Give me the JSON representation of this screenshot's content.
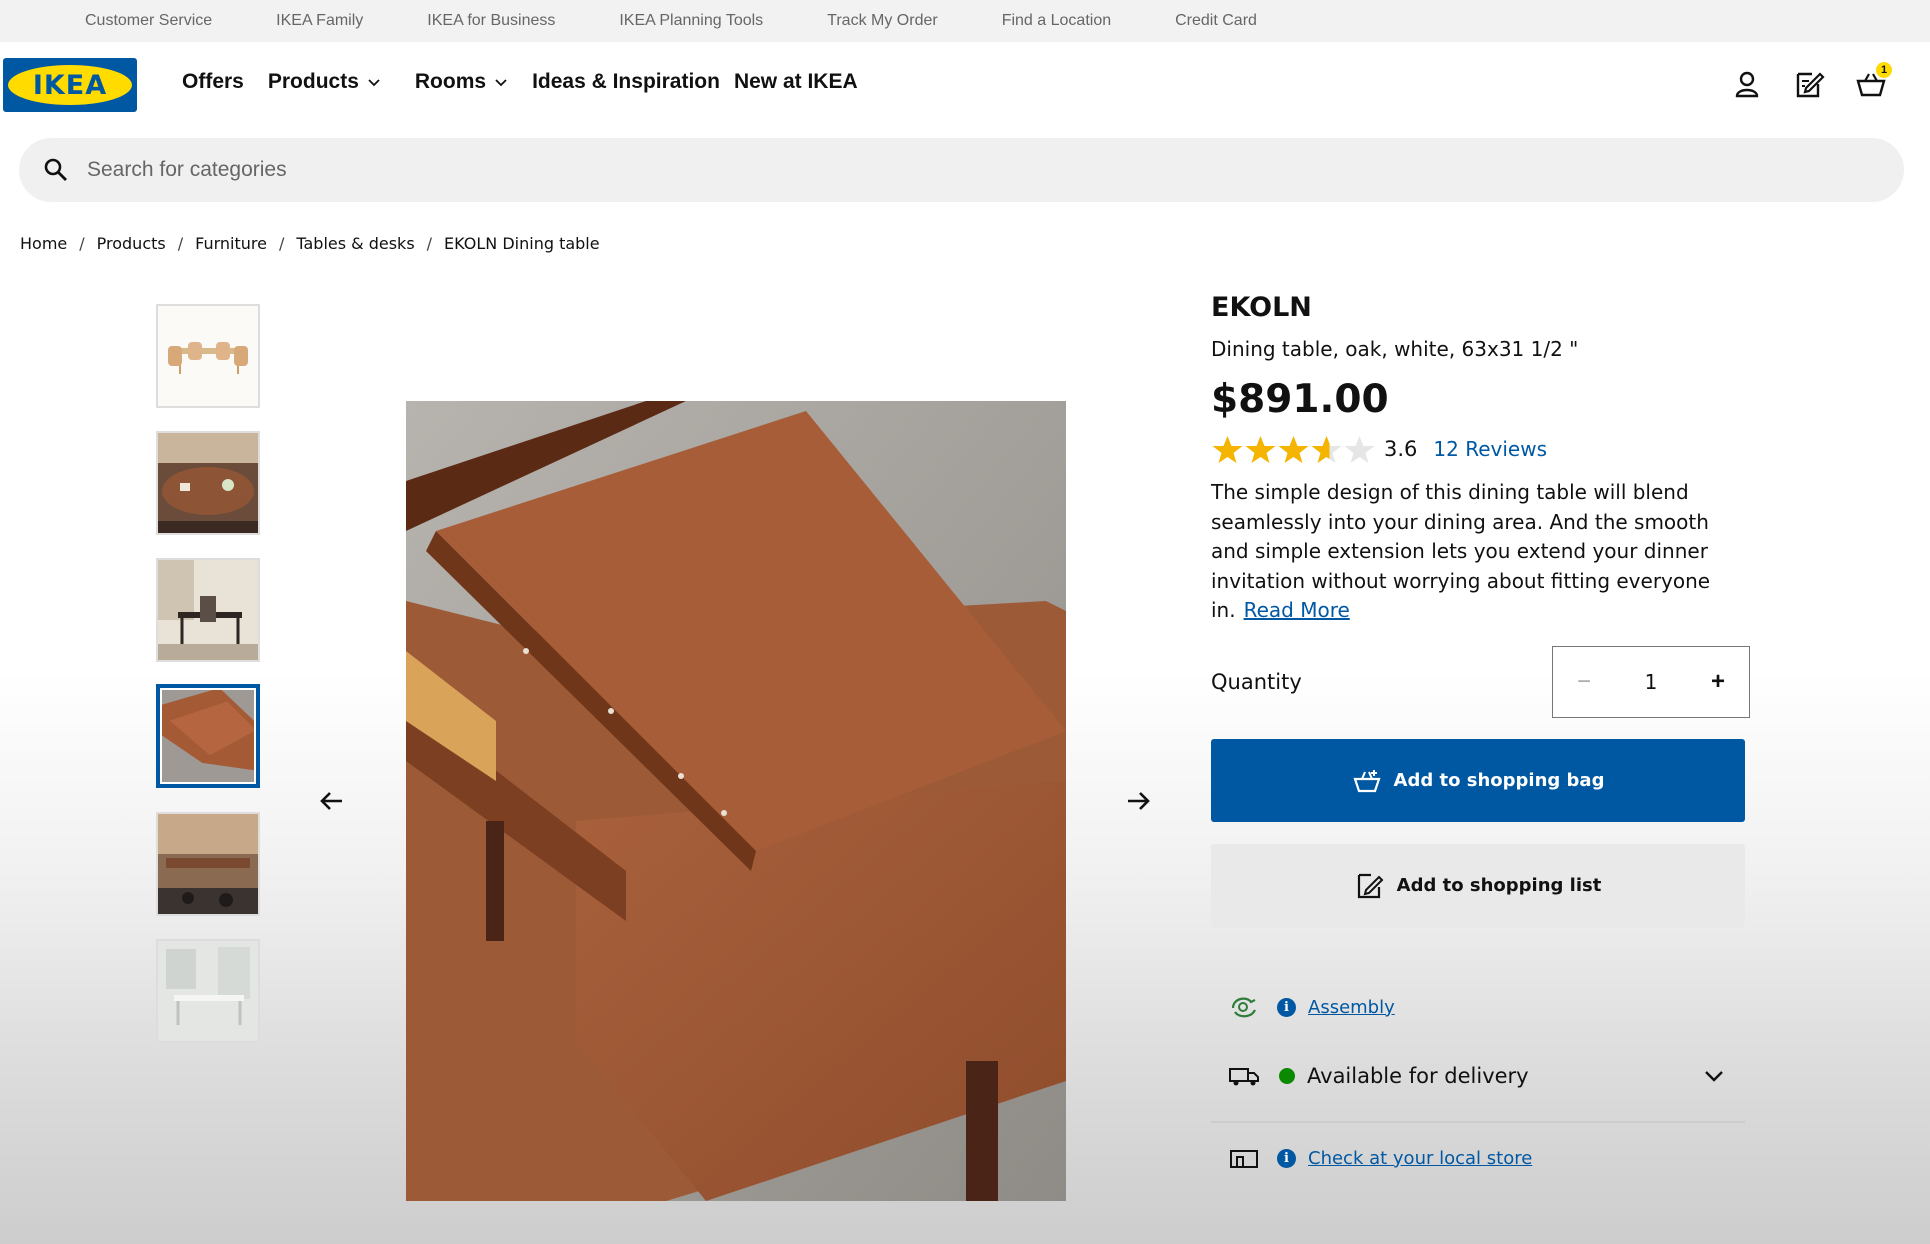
{
  "utility": [
    "Customer Service",
    "IKEA Family",
    "IKEA for Business",
    "IKEA Planning Tools",
    "Track My Order",
    "Find a Location",
    "Credit Card"
  ],
  "logo": {
    "text": "IKEA"
  },
  "nav": {
    "offers": "Offers",
    "products": "Products",
    "rooms": "Rooms",
    "ideas": "Ideas & Inspiration",
    "new": "New at IKEA"
  },
  "cart": {
    "count": "1"
  },
  "search": {
    "placeholder": "Search for categories"
  },
  "breadcrumb": [
    "Home",
    "Products",
    "Furniture",
    "Tables & desks",
    "EKOLN Dining table"
  ],
  "product": {
    "name": "EKOLN",
    "description": "Dining table, oak, white, 63x31 1/2 \"",
    "price": "$891.00",
    "rating": "3.6",
    "rating_value": 3.6,
    "rating_max": 5,
    "reviews": "12 Reviews",
    "summary": "The simple design of this dining table will blend seamlessly into your dining area. And the smooth and simple extension lets you extend your dinner invitation without worrying about fitting everyone in.",
    "read_more": "Read More"
  },
  "quantity": {
    "label": "Quantity",
    "value": "1",
    "minus": "−",
    "plus": "+"
  },
  "buttons": {
    "add_to_bag": "Add to shopping bag",
    "add_to_list": "Add to shopping list"
  },
  "services": {
    "assembly": "Assembly",
    "delivery": "Available for delivery",
    "store": "Check at your local store"
  },
  "gallery": {
    "thumb_count": 6,
    "active_index": 3
  },
  "colors": {
    "ikea_blue": "#0058a3",
    "ikea_yellow": "#ffdb00",
    "star": "#f5b400",
    "available_green": "#0a8a00"
  }
}
